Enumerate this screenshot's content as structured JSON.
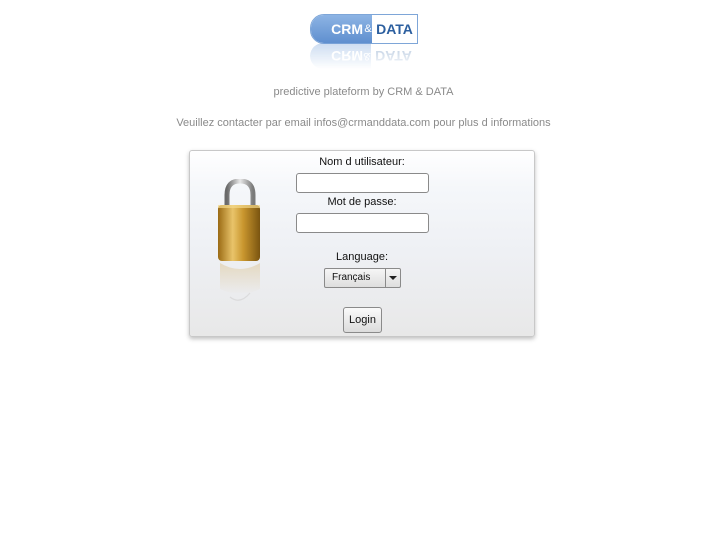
{
  "logo": {
    "left_word": "CRM",
    "amp": "&",
    "right_word": "DATA"
  },
  "tagline": "predictive plateform by CRM & DATA",
  "contact_text": "Veuillez contacter par email infos@crmanddata.com pour plus d informations",
  "login": {
    "username_label": "Nom d utilisateur:",
    "username_value": "",
    "password_label": "Mot de passe:",
    "password_value": "",
    "language_label": "Language:",
    "language_selected": "Français",
    "submit_label": "Login"
  },
  "icons": {
    "lock": "padlock-icon",
    "dropdown": "chevron-down-icon"
  },
  "colors": {
    "logo_blue": "#5f8fcf",
    "logo_text_dark": "#2c5f9f",
    "muted_text": "#8a8a8a"
  }
}
